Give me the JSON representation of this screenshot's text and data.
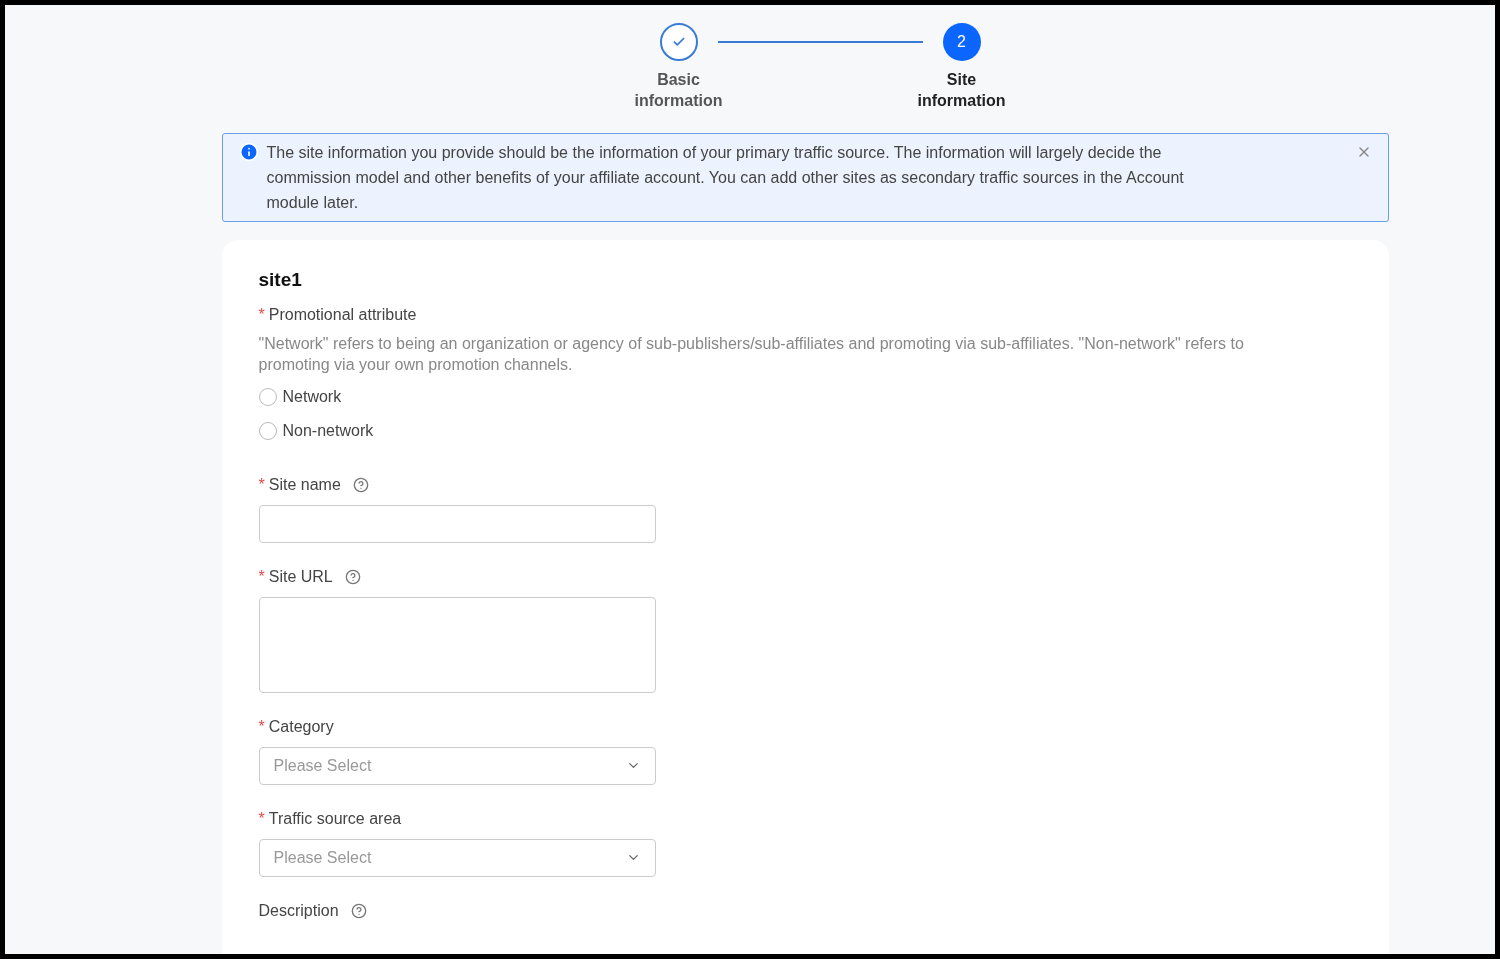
{
  "steps": [
    {
      "label": "Basic information",
      "done": true
    },
    {
      "label": "Site information",
      "done": false,
      "number": "2"
    }
  ],
  "alert": {
    "text": "The site information you provide should be the information of your primary traffic source. The information will largely decide the commission model and other benefits of your affiliate account. You can add other sites as secondary traffic sources in the Account module later."
  },
  "site": {
    "title": "site1",
    "attribute": {
      "label": "Promotional attribute",
      "required_mark": "*",
      "hint": "\"Network\" refers to being an organization or agency of sub-publishers/sub-affiliates and promoting via sub-affiliates. \"Non-network\" refers to promoting via your own promotion channels.",
      "options": [
        {
          "label": "Network",
          "selected": false
        },
        {
          "label": "Non-network",
          "selected": false
        }
      ]
    },
    "fields": [
      {
        "kind": "text",
        "label": "Site name",
        "required_mark": "*",
        "help": true
      },
      {
        "kind": "textarea",
        "label": "Site URL",
        "required_mark": "*",
        "help": true
      },
      {
        "kind": "select",
        "label": "Category",
        "required_mark": "*",
        "placeholder": "Please Select"
      },
      {
        "kind": "select",
        "label": "Traffic source area",
        "required_mark": "*",
        "placeholder": "Please Select"
      },
      {
        "kind": "none",
        "label": "Description",
        "help": true
      }
    ]
  }
}
